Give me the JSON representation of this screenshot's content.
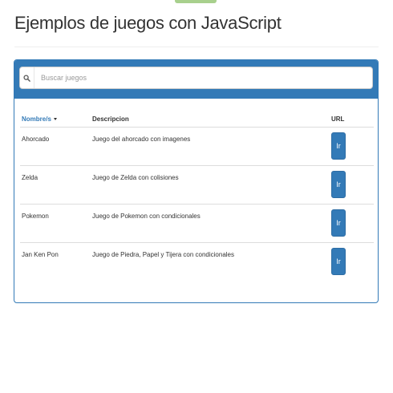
{
  "page": {
    "title": "Ejemplos de juegos con JavaScript"
  },
  "search": {
    "placeholder": "Buscar juegos",
    "value": ""
  },
  "table": {
    "headers": {
      "name": "Nombre/s",
      "description": "Descripcion",
      "url": "URL"
    },
    "sorted_column": "name",
    "rows": [
      {
        "name": "Ahorcado",
        "description": "Juego del ahorcado con imagenes",
        "button": "Ir"
      },
      {
        "name": "Zelda",
        "description": "Juego de Zelda con colisiones",
        "button": "Ir"
      },
      {
        "name": "Pokemon",
        "description": "Juego de Pokemon con condicionales",
        "button": "Ir"
      },
      {
        "name": "Jan Ken Pon",
        "description": "Juego de Piedra, Papel y Tijera con condicionales",
        "button": "Ir"
      }
    ]
  },
  "icons": {
    "search": "search-icon",
    "sort": "caret-down-icon"
  },
  "colors": {
    "primary": "#337ab7",
    "top_tab": "#a8d08d"
  }
}
